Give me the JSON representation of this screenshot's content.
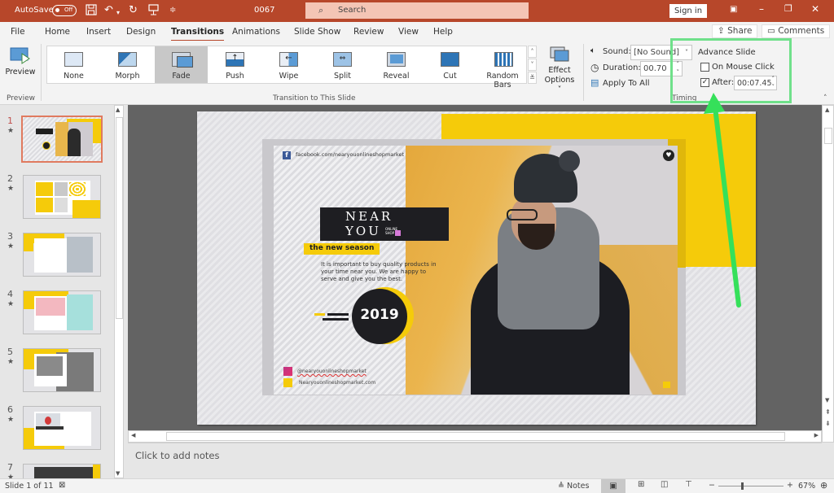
{
  "titlebar": {
    "autosave_label": "AutoSave",
    "autosave_state": "Off",
    "doc_title": "0067",
    "search_placeholder": "Search",
    "signin_label": "Sign in",
    "window_controls": [
      "ribbon-display-options",
      "minimize",
      "restore",
      "close"
    ]
  },
  "quick_access": [
    "save-icon",
    "undo-icon",
    "redo-icon",
    "present-icon",
    "customize-icon"
  ],
  "tabs": [
    "File",
    "Home",
    "Insert",
    "Design",
    "Transitions",
    "Animations",
    "Slide Show",
    "Review",
    "View",
    "Help"
  ],
  "active_tab": "Transitions",
  "share_label": "Share",
  "comments_label": "Comments",
  "ribbon": {
    "preview": {
      "button_label": "Preview",
      "group_label": "Preview"
    },
    "transitions": {
      "group_label": "Transition to This Slide",
      "items": [
        "None",
        "Morph",
        "Fade",
        "Push",
        "Wipe",
        "Split",
        "Reveal",
        "Cut",
        "Random Bars"
      ],
      "selected": "Fade",
      "effect_options_line1": "Effect",
      "effect_options_line2": "Options"
    },
    "timing": {
      "group_label": "Timing",
      "sound_label": "Sound:",
      "sound_value": "[No Sound]",
      "duration_label": "Duration:",
      "duration_value": "00.70",
      "apply_all_label": "Apply To All",
      "advance_title": "Advance Slide",
      "on_mouse_click_label": "On Mouse Click",
      "on_mouse_click_checked": false,
      "after_label": "After:",
      "after_checked": true,
      "after_value": "00:07.45"
    }
  },
  "annotation": {
    "color": "#6fe08a",
    "type": "highlight-box-and-arrow"
  },
  "thumbnails": [
    {
      "number": "1",
      "selected": true
    },
    {
      "number": "2",
      "selected": false
    },
    {
      "number": "3",
      "selected": false
    },
    {
      "number": "4",
      "selected": false
    },
    {
      "number": "5",
      "selected": false
    },
    {
      "number": "6",
      "selected": false
    },
    {
      "number": "7",
      "selected": false
    }
  ],
  "thumb_star": "★",
  "slide": {
    "facebook_text": "facebook.com/nearyouonlineshopmarket",
    "brand_line1": "NEAR",
    "brand_line2": "YOU",
    "brand_small1": "ONLINE",
    "brand_small2": "SHOP",
    "tagline": "the new season",
    "body_text": "It is important to buy quality products in your time near you. We are happy to serve and give you the best.",
    "year": "2019",
    "instagram_text": "@nearyouonlineshopmarket",
    "website_text": "Nearyouonlineshopmarket.com",
    "accent_color": "#f5cb0a"
  },
  "notes_placeholder": "Click to add notes",
  "status": {
    "slide_info": "Slide 1 of 11",
    "notes_label": "Notes",
    "zoom_level": "67%",
    "zoom_minus": "−",
    "zoom_plus": "+",
    "zoom_fraction": 0.35
  }
}
